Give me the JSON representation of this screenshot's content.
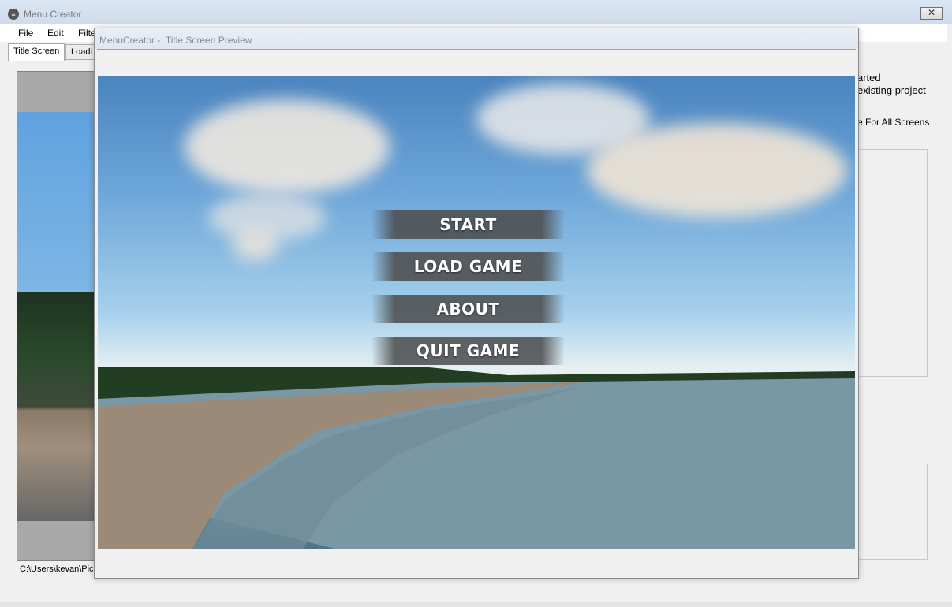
{
  "main_window": {
    "title": "Menu Creator",
    "close_glyph": "✕",
    "menu": [
      "File",
      "Edit",
      "Filte"
    ],
    "tabs": [
      "Title Screen",
      "Loadi"
    ],
    "path_label": "C:\\Users\\kevan\\Pic",
    "right_text": [
      "arted",
      "existing project",
      "e For All Screens"
    ]
  },
  "preview_window": {
    "title": "MenuCreator -  Title Screen Preview",
    "buttons": [
      "START",
      "LOAD GAME",
      "ABOUT",
      "QUIT GAME"
    ]
  },
  "icons": {
    "app": "app-menu-icon",
    "close": "close-icon"
  },
  "colors": {
    "titlebar": "#cfdced",
    "button_bg": "#4b4b4b",
    "window_bg": "#f0f0f0"
  }
}
